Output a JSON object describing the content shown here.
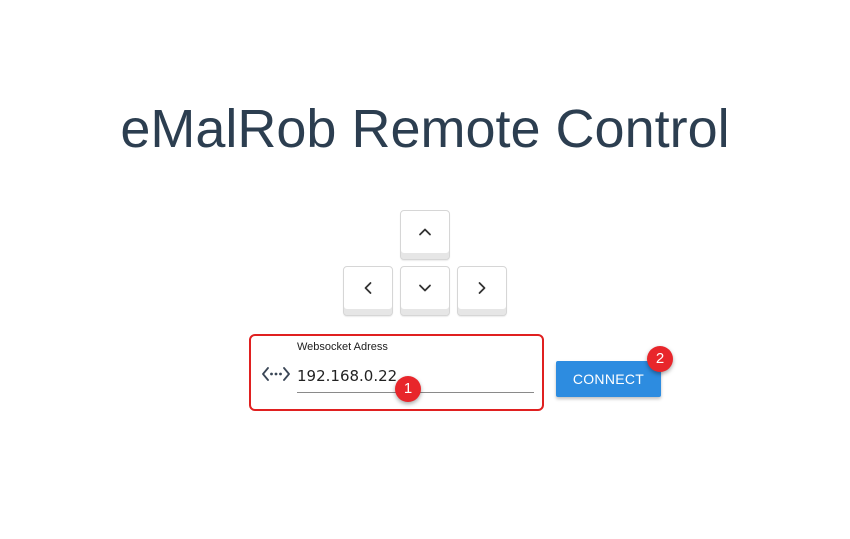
{
  "page": {
    "title": "eMalRob Remote Control"
  },
  "controls": {
    "up_icon": "chevron-up-icon",
    "left_icon": "chevron-left-icon",
    "down_icon": "chevron-down-icon",
    "right_icon": "chevron-right-icon"
  },
  "connection": {
    "label": "Websocket Adress",
    "value": "192.168.0.22",
    "icon": "network-icon",
    "connect_label": "CONNECT"
  },
  "annotations": {
    "marker_1": "1",
    "marker_2": "2"
  },
  "colors": {
    "title": "#2c3e50",
    "button": "#2d8ce0",
    "annotation": "#e8262b"
  }
}
